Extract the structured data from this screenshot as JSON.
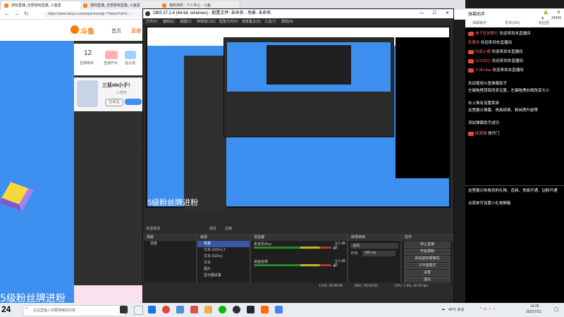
{
  "browser": {
    "tabs": [
      "游戏直播_全部游戏直播_斗鱼直",
      "游戏直播_全部游戏直播_斗鱼直",
      "我的资料 - 个人中心 - 斗鱼"
    ],
    "url": "https://www.douyu.com/topic/mcdsjk-7?ddsa?rid=5..."
  },
  "site": {
    "logo": "斗鱼",
    "nav": [
      "首页",
      "直播"
    ],
    "stat_number": "12",
    "stat_label1": "直播等级",
    "stat_label2": "直播开水",
    "stat_label3": "鱼丸值",
    "streamer_name": "三亚ob小子！",
    "streamer_sub": "小角色",
    "follow_label": "已关注",
    "banner_text": "5级粉丝牌进粉"
  },
  "obs": {
    "title": "OBS 27.2.4 (64-bit, windows) - 配置文件: 未命名 - 场景: 未命名",
    "menu": [
      "文件(F)",
      "编辑(E)",
      "视图(V)",
      "停靠窗口(D)",
      "配置文件(P)",
      "场景集合(S)",
      "工具(T)",
      "帮助(H)"
    ],
    "preview_overlay": "5级粉丝牌进粉",
    "no_source_selected": "未选择源",
    "properties_btn": "属性",
    "filters_btn": "滤镜",
    "scenes_header": "场景",
    "scenes": [
      "场景"
    ],
    "sources_header": "来源",
    "sources": [
      "背景",
      "文本 (GDI+) 2",
      "文本 (GDI+)",
      "文本",
      "图片",
      "显示器采集"
    ],
    "mixer_header": "混音器",
    "mixer_tracks": [
      {
        "name": "麦克风/Aux",
        "db": "0.0 dB"
      },
      {
        "name": "桌面音频",
        "db": "0.0 dB"
      }
    ],
    "transition_header": "转场特效",
    "transition_type": "淡出",
    "transition_duration_label": "时长",
    "transition_duration": "300 ms",
    "controls_header": "控件",
    "controls": [
      "停止直播",
      "开始录制",
      "启动虚拟摄像机",
      "工作室模式",
      "设置",
      "退出"
    ],
    "status": {
      "live": "LIVE: 00:00:00",
      "rec": "REC: 00:00:00",
      "cpu": "CPU: 1.5%, 60.00 fps"
    }
  },
  "chat": {
    "title": "弹幕助手",
    "viewer_count": "24399",
    "tabs": [
      "弹幕聊天",
      "贵宾(306)",
      "粉丝团"
    ],
    "messages": [
      {
        "user": "电子狂热野行",
        "text": "欢迎来到本直播间"
      },
      {
        "user": "钞票多",
        "text": "欢迎来到本直播间"
      },
      {
        "user": "白茹小鹿",
        "text": "欢迎来到本直播间"
      },
      {
        "user": "GOOD小",
        "text": "欢迎来到本直播间"
      },
      {
        "user": "小米Vitas",
        "text": "欢迎来到本直播间"
      }
    ],
    "system_notice": [
      "欢迎使用斗鱼弹幕助手",
      "左键拖拽顶部改变位置，左键拖拽右侧改变大小",
      "右上角有设置菜单",
      "这里展示弹幕、贵族续费、粉丝牌升级等",
      "添加弹幕助手成功"
    ],
    "last_msg": {
      "user": "欧莱雅",
      "text": "快开门"
    },
    "bottom_notice": [
      "这里展示你收到的礼物、道具、贵族开通、钻粉开通",
      "点菜单可设置小礼物屏蔽"
    ]
  },
  "taskbar": {
    "search_placeholder": "在这里输入你要搜索的内容",
    "temperature": "40°C 多云",
    "time": "14:25",
    "date": "2022/7/21",
    "num": "24"
  }
}
